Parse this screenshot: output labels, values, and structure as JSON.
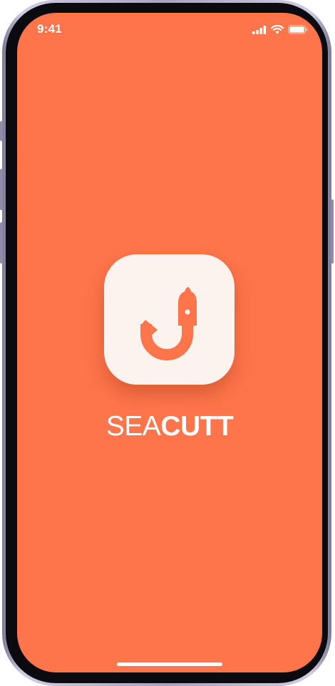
{
  "status_bar": {
    "time": "9:41",
    "icons": [
      "cellular-signal-icon",
      "wifi-icon",
      "battery-icon"
    ]
  },
  "splash": {
    "app_icon": "fish-hook-icon",
    "brand_light": "SEA",
    "brand_bold": "CUTT"
  },
  "colors": {
    "background": "#ff754b",
    "icon_tile": "#fdf3ee",
    "icon_glyph": "#ff754b",
    "text": "#ffffff"
  }
}
